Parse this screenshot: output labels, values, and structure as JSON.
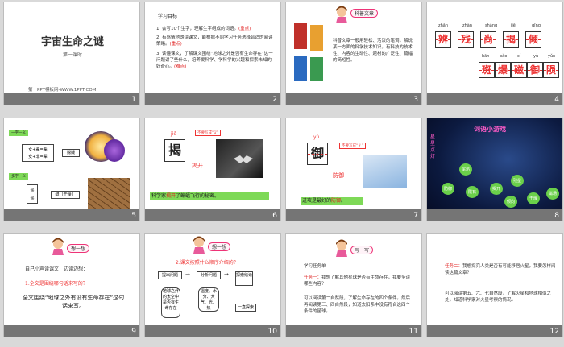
{
  "slides": [
    {
      "num": "1",
      "title": "宇宙生命之谜",
      "subtitle": "第一课时",
      "footer": "第一PPT模板网-WWW.1PPT.COM"
    },
    {
      "num": "2",
      "heading": "学习目标",
      "goals": [
        "会写10个生字，理解生字组成的词语。",
        "有感情地朗读课文，能根据不同学习任务选择合适的阅读策略。",
        "读懂课文，了解课文围绕“地球之外是否有生命存在”这一问题讲了些什么，培养爱科学、学科学的兴趣和探索未知的好奇心。"
      ],
      "tags": [
        "(重点)",
        "(重点)",
        "(难点)"
      ]
    },
    {
      "num": "3",
      "heading": "科普文章",
      "text": "科普文章一般用轻松、活泼的笔调，解说某一方面的科学技术知识。有科技的技术性、内容的生动性、题材的广泛性、篇幅的简短性。"
    },
    {
      "num": "4",
      "pinyin1": [
        "zhǎn",
        "zhàn",
        "shàng",
        "jiē",
        "qīng"
      ],
      "chars1": [
        "辨",
        "残",
        "尚",
        "揭",
        "倾"
      ],
      "pinyin2": [
        "bān",
        "bào",
        "cí",
        "yù",
        "yǔn"
      ],
      "chars2": [
        "斑",
        "爆",
        "磁",
        "御",
        "陨"
      ]
    },
    {
      "num": "5",
      "badge1": "一字一义",
      "b1": "女+辈=辈",
      "b2": "女+非=辈",
      "word1": "嫦娥",
      "badge2": "多字一义",
      "c1": "遥",
      "c2": "遥",
      "word2": "缝（干燥）"
    },
    {
      "num": "6",
      "pinyin": "jiē",
      "char": "揭",
      "note": "不要写成“ü”",
      "word": "揭开",
      "sentence_pre": "科学家",
      "sentence_hl": "揭开",
      "sentence_post": "了蝙蝠飞行的秘密。"
    },
    {
      "num": "7",
      "pinyin": "yù",
      "char": "御",
      "note": "不要写成“彳”",
      "word": "防御",
      "sentence_pre": "进攻是最好的",
      "sentence_hl": "防御",
      "sentence_post": "。"
    },
    {
      "num": "8",
      "game_title": "词语小游戏",
      "side_label": "星星点灯",
      "stars": [
        "尾焰",
        "防御",
        "陨石",
        "揭开",
        "残星",
        "倾向",
        "干燥",
        "磁场",
        "嫦娥"
      ]
    },
    {
      "num": "9",
      "heading": "想一想",
      "line1": "自己小声读课文，边读边想：",
      "line2": "1.全文是围绕哪句话来写的？",
      "line3": "全文围绕“地球之外有没有生命存在”这句话来写。"
    },
    {
      "num": "10",
      "heading": "想一想",
      "question": "2.课文按照什么顺序介绍的？",
      "flow": [
        "提出问题",
        "分析问题",
        "探索结论"
      ],
      "detail1": "地球之外的太空中是否有生命存在",
      "detail2": "温度、水分、大气、光、热",
      "detail3": "一直探索"
    },
    {
      "num": "11",
      "heading": "写一写",
      "task": "学习任务单",
      "t1_label": "任务一：",
      "t1": "我想了解其他星球是否有生命存在，我要多读哪些内容？",
      "t2": "可以阅读第二自然段，了解生命存在的四个条件。然后再阅读第三、四自然段，知道太阳系中没有符合这四个条件的星球。"
    },
    {
      "num": "12",
      "t_label": "任务二：",
      "t": "我想探究人类是否有可能移居火星，我要怎样阅读这篇文章？",
      "a": "可以阅读第五、六、七自然段，了解火星和地球相似之处，知道科学家对火星考察的情况。"
    }
  ]
}
